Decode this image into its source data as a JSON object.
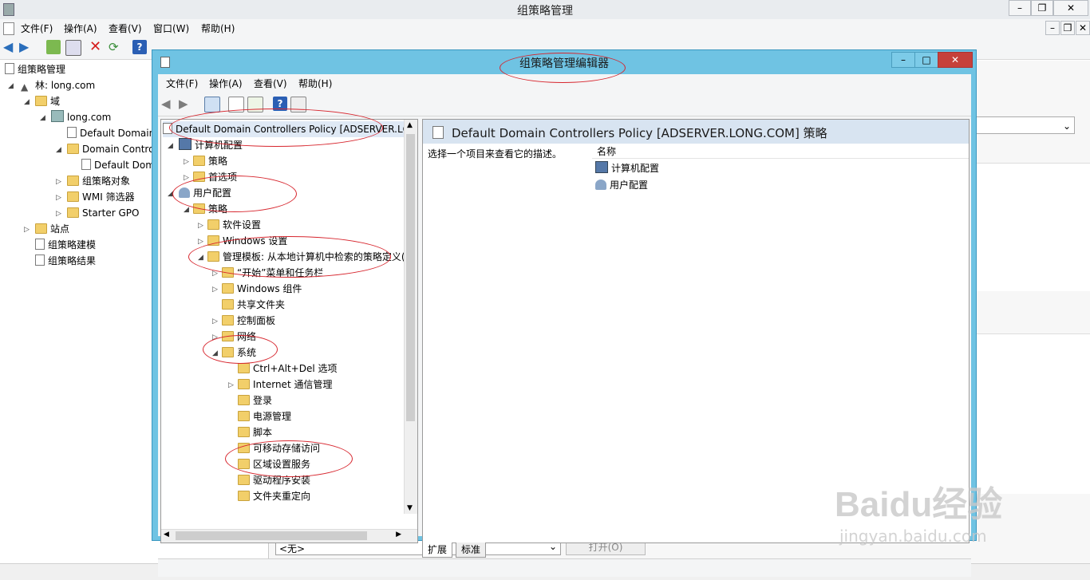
{
  "outer": {
    "title": "组策略管理",
    "menu": [
      "文件(F)",
      "操作(A)",
      "查看(V)",
      "窗口(W)",
      "帮助(H)"
    ],
    "tree": [
      {
        "label": "组策略管理",
        "indent": 0
      },
      {
        "label": "林: long.com",
        "indent": 1
      },
      {
        "label": "域",
        "indent": 2
      },
      {
        "label": "long.com",
        "indent": 3
      },
      {
        "label": "Default Domain",
        "indent": 4
      },
      {
        "label": "Domain Contro",
        "indent": 4
      },
      {
        "label": "Default Dom",
        "indent": 5
      },
      {
        "label": "组策略对象",
        "indent": 4
      },
      {
        "label": "WMI 筛选器",
        "indent": 4
      },
      {
        "label": "Starter GPO",
        "indent": 4
      },
      {
        "label": "站点",
        "indent": 2
      },
      {
        "label": "组策略建模",
        "indent": 2
      },
      {
        "label": "组策略结果",
        "indent": 2
      }
    ],
    "bottom_select": "<无>",
    "open_button": "打开(O)"
  },
  "inner": {
    "title": "组策略管理编辑器",
    "menu": [
      "文件(F)",
      "操作(A)",
      "查看(V)",
      "帮助(H)"
    ],
    "tree_root": "Default Domain Controllers Policy [ADSERVER.LC",
    "tree": [
      {
        "label": "计算机配置"
      },
      {
        "label": "策略"
      },
      {
        "label": "首选项"
      },
      {
        "label": "用户配置"
      },
      {
        "label": "策略"
      },
      {
        "label": "软件设置"
      },
      {
        "label": "Windows 设置"
      },
      {
        "label": "管理模板: 从本地计算机中检索的策略定义("
      },
      {
        "label": "“开始”菜单和任务栏"
      },
      {
        "label": "Windows 组件"
      },
      {
        "label": "共享文件夹"
      },
      {
        "label": "控制面板"
      },
      {
        "label": "网络"
      },
      {
        "label": "系统"
      },
      {
        "label": "Ctrl+Alt+Del 选项"
      },
      {
        "label": "Internet 通信管理"
      },
      {
        "label": "登录"
      },
      {
        "label": "电源管理"
      },
      {
        "label": "脚本"
      },
      {
        "label": "可移动存储访问"
      },
      {
        "label": "区域设置服务"
      },
      {
        "label": "驱动程序安装"
      },
      {
        "label": "文件夹重定向"
      }
    ],
    "right_title": "Default Domain Controllers Policy [ADSERVER.LONG.COM] 策略",
    "description": "选择一个项目来查看它的描述。",
    "column_name": "名称",
    "items": [
      "计算机配置",
      "用户配置"
    ],
    "tabs": [
      "扩展",
      "标准"
    ]
  },
  "watermark": {
    "text": "Baidu经验",
    "sub": "jingyan.baidu.com"
  },
  "colors": {
    "inner_frame": "#6fc3e3",
    "annotation": "#d7262e",
    "header_band": "#d8e4f1"
  }
}
